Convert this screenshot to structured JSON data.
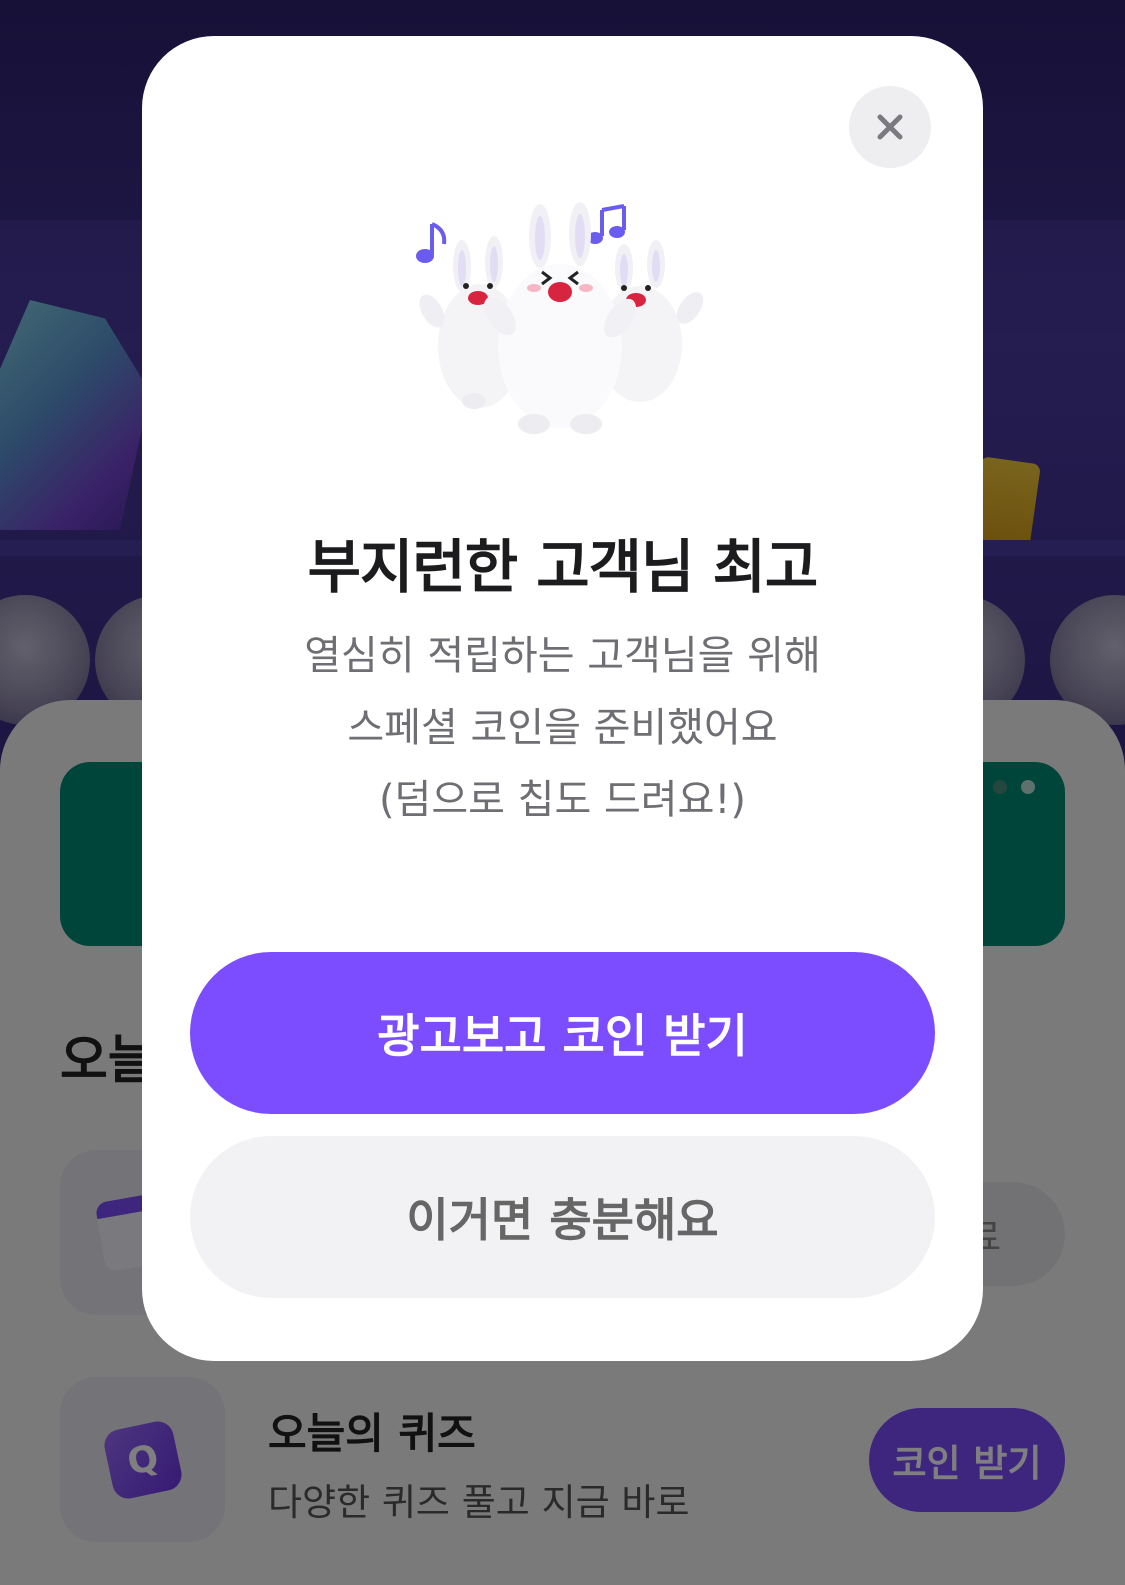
{
  "modal": {
    "close_icon": "close-icon",
    "title": "부지런한 고객님 최고",
    "description_lines": [
      "열심히 적립하는 고객님을 위해",
      "스페셜 코인을 준비했어요",
      "(덤으로 칩도 드려요!)"
    ],
    "primary_button": "광고보고 코인 받기",
    "secondary_button": "이거면 충분해요",
    "illustration": "dancing-bunnies-illustration"
  },
  "background": {
    "section_title": "오늘",
    "tasks": [
      {
        "icon": "calendar-icon",
        "status_button": "완료"
      },
      {
        "icon": "quiz-icon",
        "icon_letter": "Q",
        "title": "오늘의 퀴즈",
        "description": "다양한 퀴즈 풀고 지금 바로",
        "action_button": "코인 받기"
      }
    ]
  },
  "colors": {
    "accent": "#7c4dff",
    "banner": "#008b73",
    "dim": "rgba(0,0,0,0.5)"
  }
}
